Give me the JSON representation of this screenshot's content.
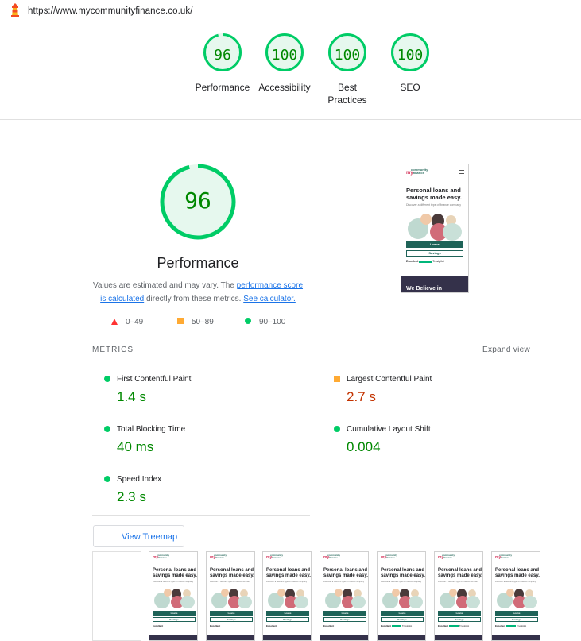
{
  "url": "https://www.mycommunityfinance.co.uk/",
  "gauges": [
    {
      "label": "Performance",
      "score": "96"
    },
    {
      "label": "Accessibility",
      "score": "100"
    },
    {
      "label": "Best Practices",
      "score": "100"
    },
    {
      "label": "SEO",
      "score": "100"
    }
  ],
  "performance": {
    "score": "96",
    "title": "Performance",
    "note_prefix": "Values are estimated and may vary. The ",
    "note_link1": "performance score is calculated",
    "note_middle": " directly from these metrics. ",
    "note_link2": "See calculator.",
    "legend": [
      "0–49",
      "50–89",
      "90–100"
    ]
  },
  "colors": {
    "pass": "#00cc66",
    "average": "#ffaa33",
    "fail": "#ff3333",
    "pass_text": "#008800",
    "avg_text": "#c33300",
    "link": "#1a73e8"
  },
  "metrics": {
    "heading": "METRICS",
    "expand": "Expand view",
    "items": [
      {
        "name": "First Contentful Paint",
        "value": "1.4 s",
        "status": "pass"
      },
      {
        "name": "Largest Contentful Paint",
        "value": "2.7 s",
        "status": "average"
      },
      {
        "name": "Total Blocking Time",
        "value": "40 ms",
        "status": "pass"
      },
      {
        "name": "Cumulative Layout Shift",
        "value": "0.004",
        "status": "pass"
      },
      {
        "name": "Speed Index",
        "value": "2.3 s",
        "status": "pass"
      }
    ]
  },
  "treemap_label": "View Treemap",
  "screenshot": {
    "logo_top": "community",
    "logo_my": "my",
    "logo_bottom": "finance",
    "headline": "Personal loans and savings made easy.",
    "sub": "Discover a different type of finance company",
    "btn_loans": "Loans",
    "btn_savings": "Savings",
    "rating_label": "Excellent",
    "rating_source": "Trustpilot",
    "banner": "We Believe in"
  }
}
